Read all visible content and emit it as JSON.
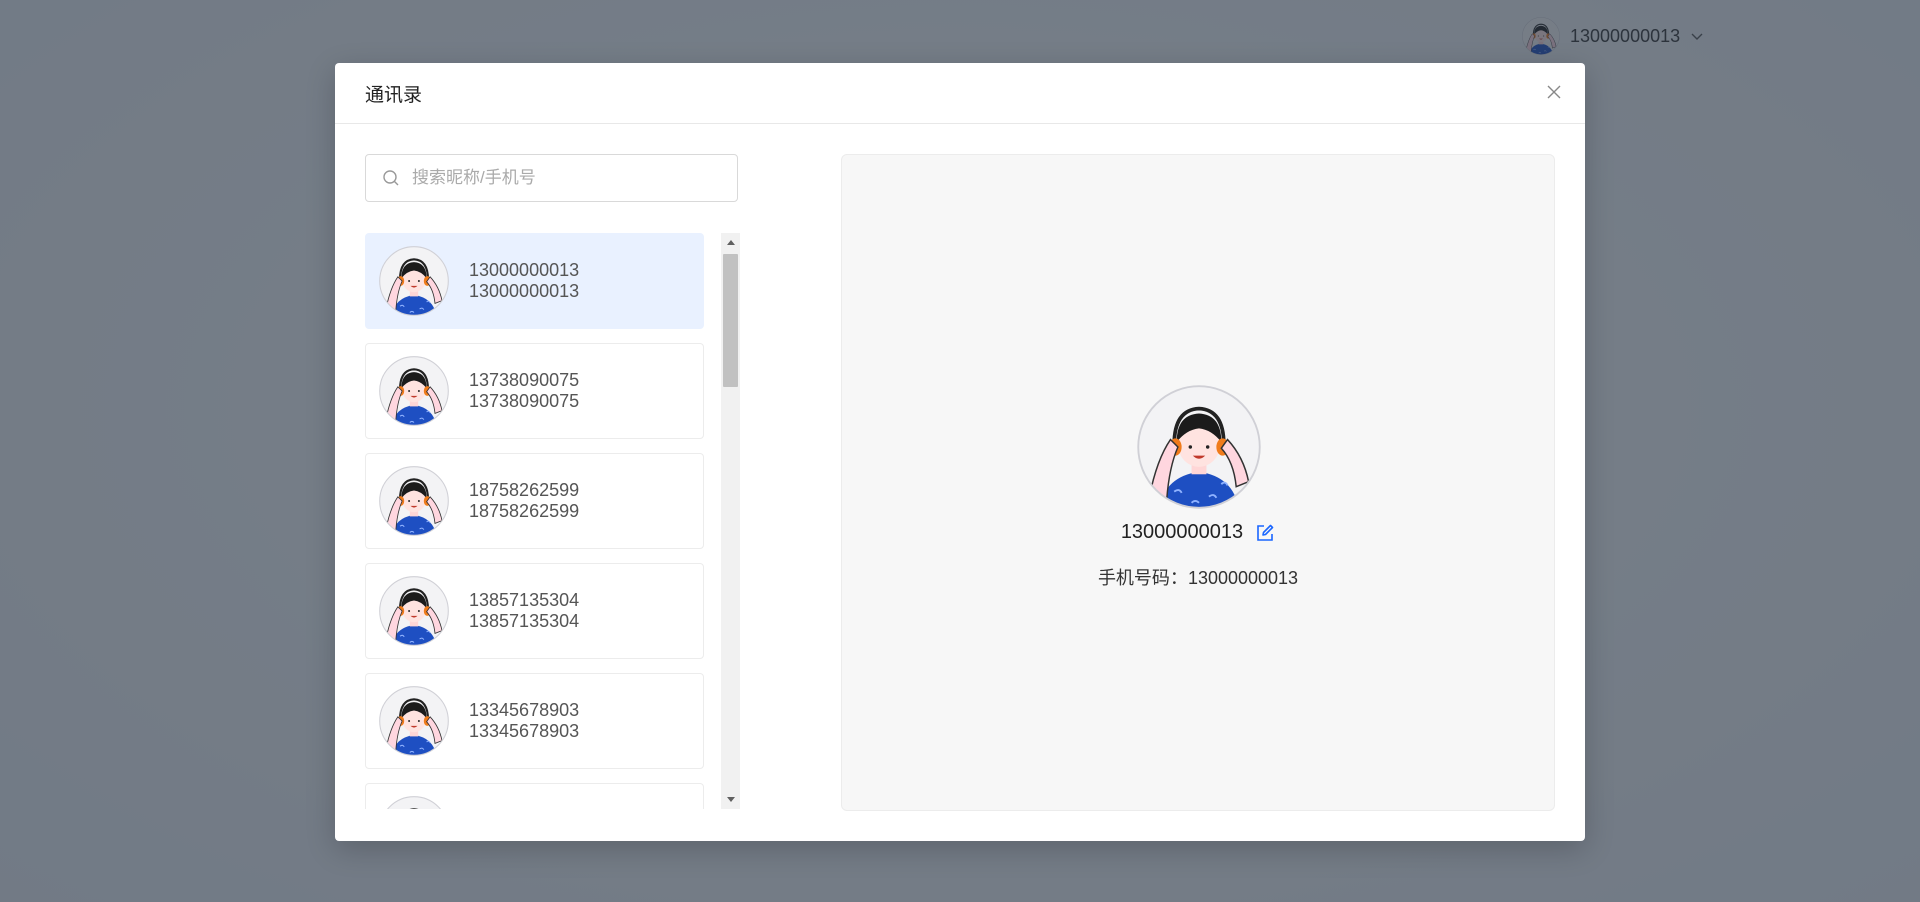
{
  "topbar": {
    "username": "13000000013",
    "avatar_icon": "avatar-girl-headphones-icon",
    "dropdown_icon": "chevron-down-icon"
  },
  "dialog": {
    "title": "通讯录",
    "close_icon": "close-icon"
  },
  "search": {
    "placeholder": "搜索昵称/手机号",
    "value": "",
    "icon": "search-icon"
  },
  "contacts": [
    {
      "nickname": "13000000013",
      "phone": "13000000013",
      "active": true
    },
    {
      "nickname": "13738090075",
      "phone": "13738090075",
      "active": false
    },
    {
      "nickname": "18758262599",
      "phone": "18758262599",
      "active": false
    },
    {
      "nickname": "13857135304",
      "phone": "13857135304",
      "active": false
    },
    {
      "nickname": "13345678903",
      "phone": "13345678903",
      "active": false
    },
    {
      "nickname": "",
      "phone": "",
      "active": false
    }
  ],
  "detail": {
    "nickname": "13000000013",
    "phone_label": "手机号码：",
    "phone": "13000000013",
    "edit_icon": "edit-icon"
  },
  "colors": {
    "active_item_bg": "#e9f1ff",
    "accent": "#1a66ff",
    "mask": "#283442"
  }
}
